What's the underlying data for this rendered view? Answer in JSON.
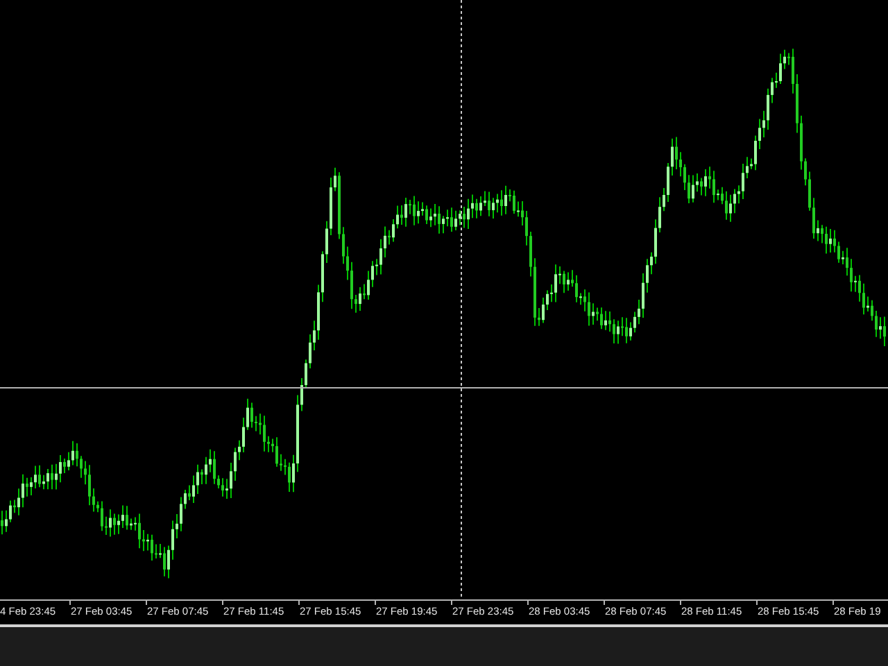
{
  "chart": {
    "time_labels": [
      "4 Feb 23:45",
      "27 Feb 03:45",
      "27 Feb 07:45",
      "27 Feb 11:45",
      "27 Feb 15:45",
      "27 Feb 19:45",
      "27 Feb 23:45",
      "28 Feb 03:45",
      "28 Feb 07:45",
      "28 Feb 11:45",
      "28 Feb 15:45",
      "28 Feb 19"
    ]
  }
}
